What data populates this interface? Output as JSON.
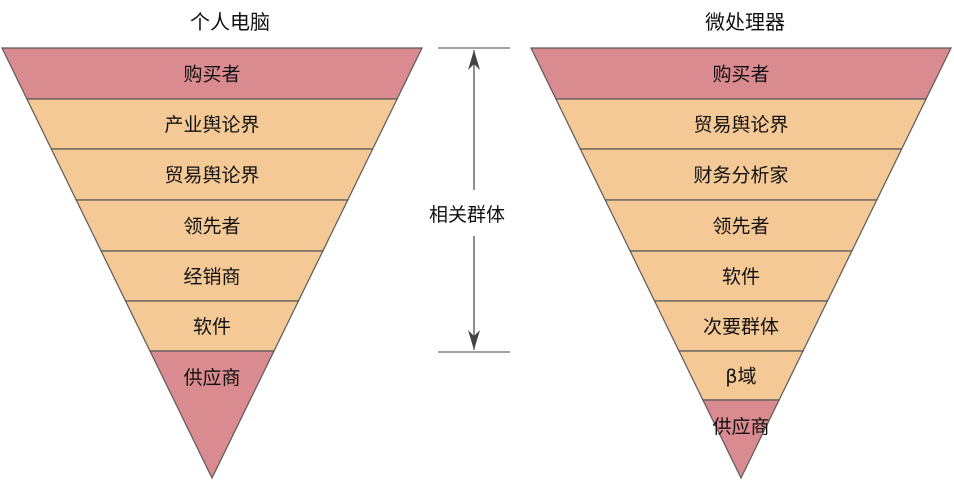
{
  "diagram": {
    "left_title": "个人电脑",
    "right_title": "微处理器",
    "middle_label": "相关群体",
    "colors": {
      "pink": "#d98b8f",
      "tan": "#f4c995",
      "line": "#5a5a5a",
      "arrow": "#444444"
    },
    "left_levels": [
      {
        "label": "购买者",
        "tone": "pink"
      },
      {
        "label": "产业舆论界",
        "tone": "tan"
      },
      {
        "label": "贸易舆论界",
        "tone": "tan"
      },
      {
        "label": "领先者",
        "tone": "tan"
      },
      {
        "label": "经销商",
        "tone": "tan"
      },
      {
        "label": "软件",
        "tone": "tan"
      },
      {
        "label": "供应商",
        "tone": "pink"
      }
    ],
    "right_levels": [
      {
        "label": "购买者",
        "tone": "pink"
      },
      {
        "label": "贸易舆论界",
        "tone": "tan"
      },
      {
        "label": "财务分析家",
        "tone": "tan"
      },
      {
        "label": "领先者",
        "tone": "tan"
      },
      {
        "label": "软件",
        "tone": "tan"
      },
      {
        "label": "次要群体",
        "tone": "tan"
      },
      {
        "label": "β域",
        "tone": "tan"
      },
      {
        "label": "供应商",
        "tone": "pink"
      }
    ]
  }
}
